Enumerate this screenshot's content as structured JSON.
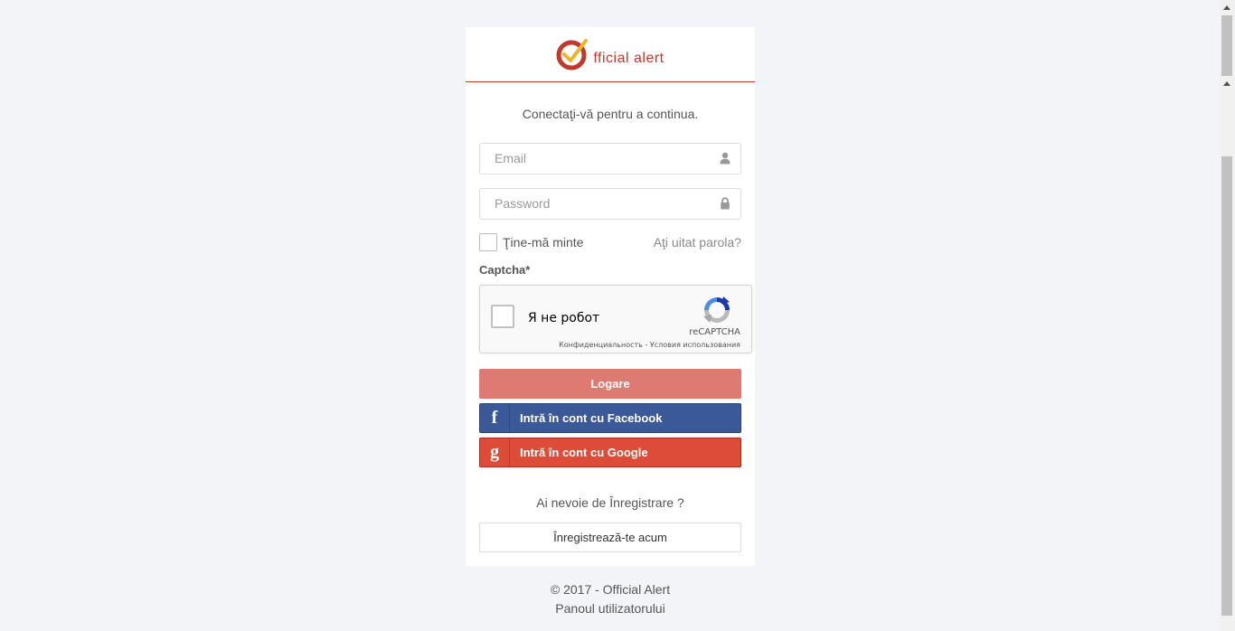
{
  "brand": {
    "logo_text": "fficial alert",
    "accent_color": "#c0392b"
  },
  "login": {
    "subtitle": "Conectaţi-vă pentru a continua.",
    "email_placeholder": "Email",
    "password_placeholder": "Password",
    "remember_label": "Ţine-mă minte",
    "forgot_link": "Aţi uitat parola?",
    "captcha_label": "Captcha*",
    "login_button": "Logare",
    "facebook_button": "Intră în cont cu Facebook",
    "google_button": "Intră în cont cu Google",
    "need_register": "Ai nevoie de Înregistrare ?",
    "register_button": "Înregistrează-te acum"
  },
  "recaptcha": {
    "checkbox_text": "Я не робот",
    "brand": "reCAPTCHA",
    "links": "Конфиденциальность - Условия использования"
  },
  "social_icons": {
    "facebook": "f",
    "google": "g"
  },
  "footer": {
    "copyright": "© 2017 - Official Alert",
    "subtitle": "Panoul utilizatorului"
  },
  "colors": {
    "login_button": "#dd7a72",
    "facebook": "#3b5998",
    "google": "#dd4b39"
  }
}
